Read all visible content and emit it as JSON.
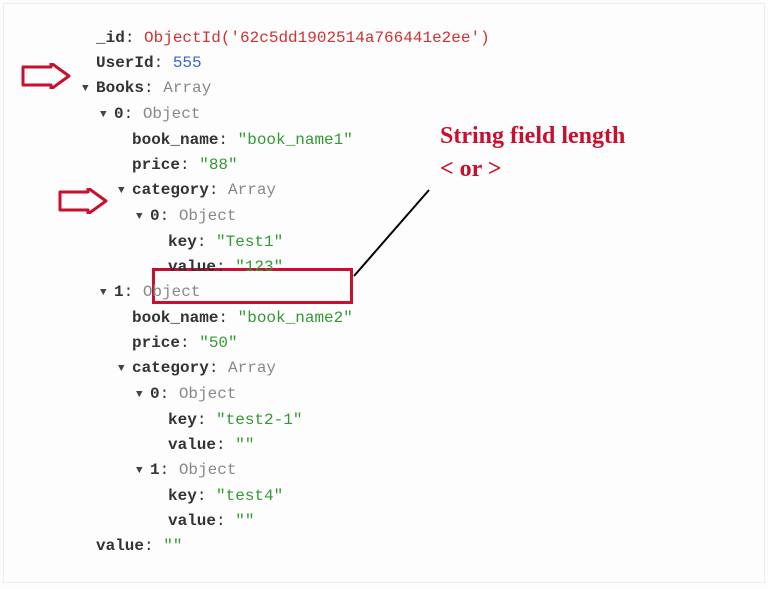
{
  "annot": {
    "title_line1": "String field length",
    "title_line2": "< or >"
  },
  "doc": {
    "id_key": "_id",
    "id_val": "ObjectId('62c5dd1902514a766441e2ee')",
    "userid_key": "UserId",
    "userid_val": "555",
    "books_key": "Books",
    "array_type": "Array",
    "object_type": "Object",
    "idx0": "0",
    "idx1": "1",
    "book_name_key": "book_name",
    "price_key": "price",
    "category_key": "category",
    "key_key": "key",
    "value_key": "value",
    "b0": {
      "name": "\"book_name1\"",
      "price": "\"88\"",
      "c0_key": "\"Test1\"",
      "c0_val": "\"123\""
    },
    "b1": {
      "name": "\"book_name2\"",
      "price": "\"50\"",
      "c0_key": "\"test2-1\"",
      "c0_val": "\"\"",
      "c1_key": "\"test4\"",
      "c1_val": "\"\""
    },
    "tail_val": "\"\""
  }
}
